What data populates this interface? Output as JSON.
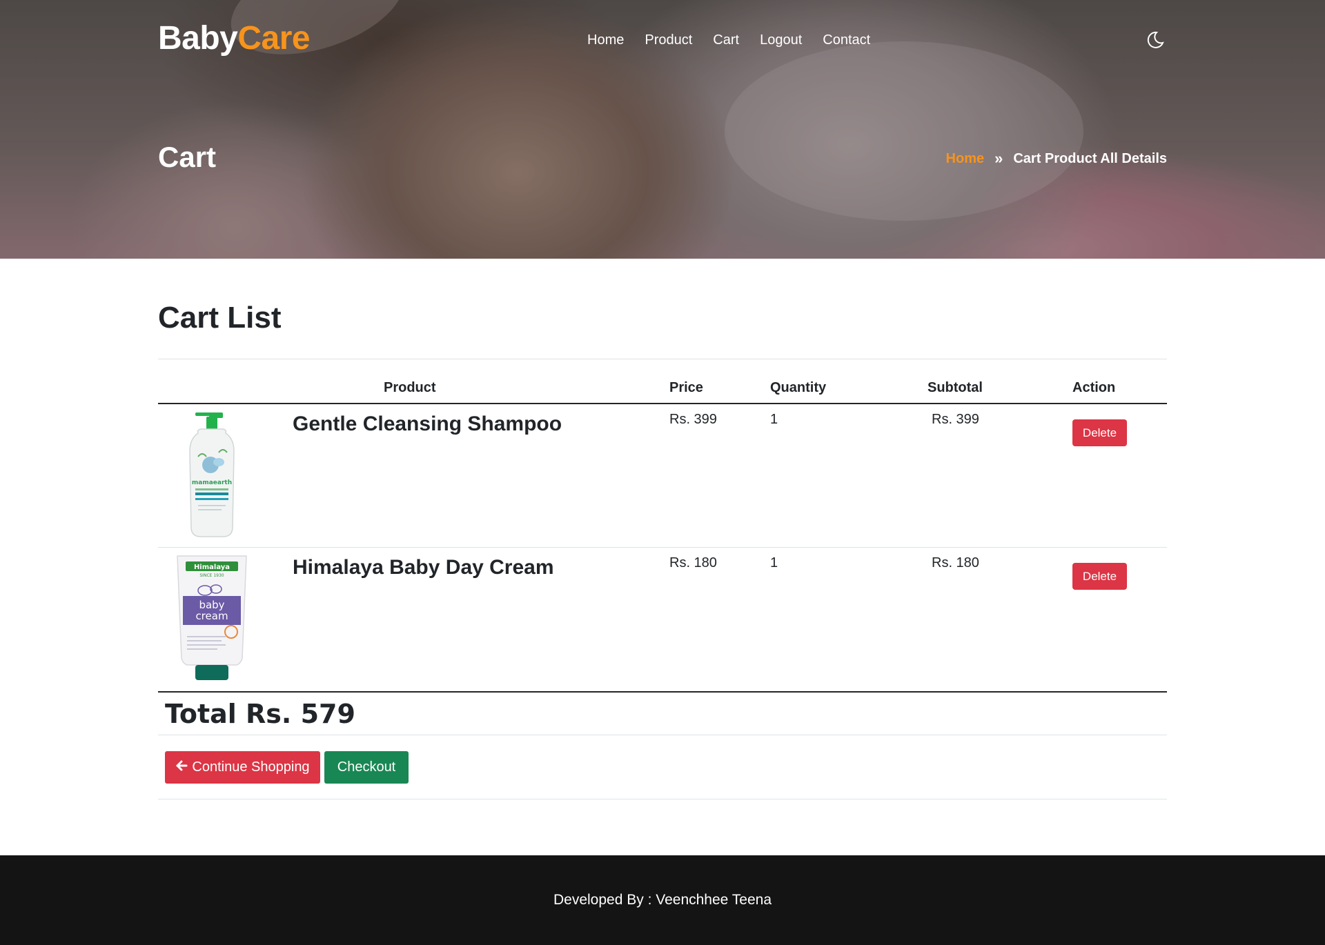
{
  "brand": {
    "part1": "Baby",
    "part2": "Care",
    "accent_color": "#f7941d"
  },
  "nav": {
    "items": [
      "Home",
      "Product",
      "Cart",
      "Logout",
      "Contact"
    ],
    "theme_icon": "moon-icon"
  },
  "hero": {
    "title": "Cart",
    "breadcrumb_home": "Home",
    "breadcrumb_sep": "»",
    "breadcrumb_current": "Cart Product All Details"
  },
  "cart": {
    "heading": "Cart List",
    "columns": {
      "product": "Product",
      "price": "Price",
      "quantity": "Quantity",
      "subtotal": "Subtotal",
      "action": "Action"
    },
    "items": [
      {
        "name": "Gentle Cleansing Shampoo",
        "price": "Rs. 399",
        "quantity": "1",
        "subtotal": "Rs. 399",
        "action": "Delete",
        "image": "shampoo-bottle-image"
      },
      {
        "name": "Himalaya Baby Day Cream",
        "price": "Rs. 180",
        "quantity": "1",
        "subtotal": "Rs. 180",
        "action": "Delete",
        "image": "cream-tube-image"
      }
    ],
    "total": "Total Rs. 579",
    "continue_label": "Continue Shopping",
    "checkout_label": "Checkout"
  },
  "product_images": {
    "shampoo": {
      "brand": "mamaearth"
    },
    "cream": {
      "brand": "Himalaya",
      "since": "SINCE 1930",
      "line1": "baby",
      "line2": "cream"
    }
  },
  "colors": {
    "danger": "#dc3545",
    "success": "#198754",
    "footer_bg": "#141414"
  },
  "footer": {
    "text": "Developed By : Veenchhee Teena"
  }
}
